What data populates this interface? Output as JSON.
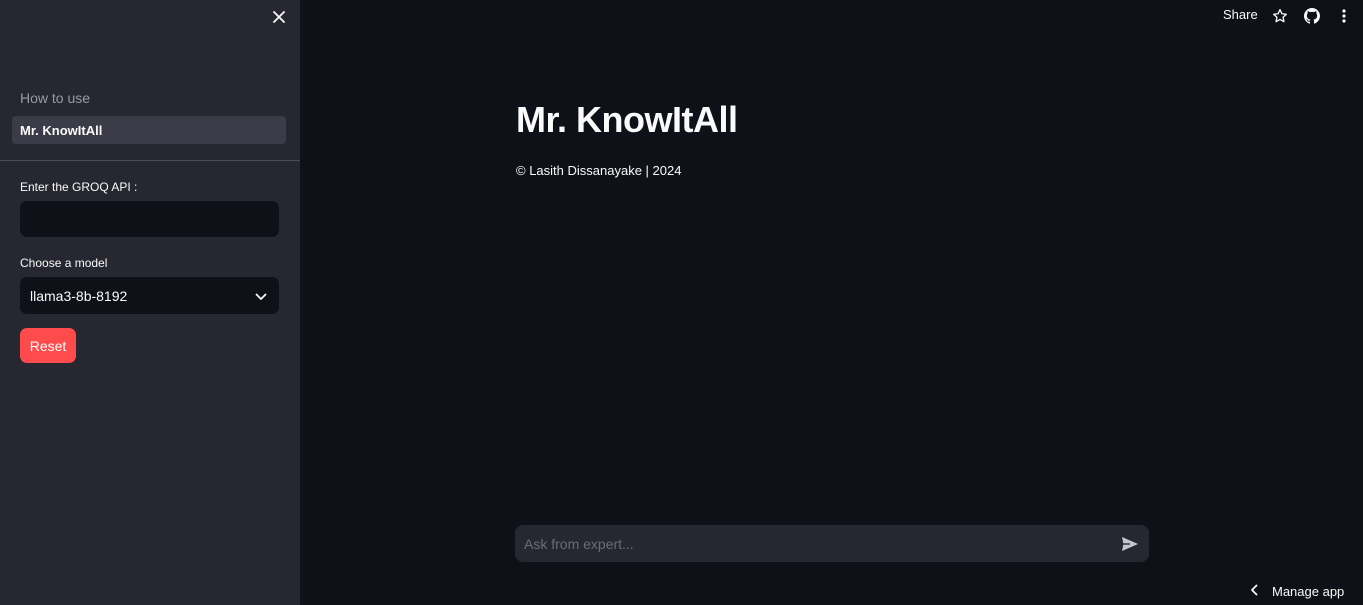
{
  "sidebar": {
    "close_icon": "close-icon",
    "nav": [
      {
        "label": "How to use",
        "active": false
      },
      {
        "label": "Mr. KnowItAll",
        "active": true
      }
    ],
    "api_field": {
      "label": "Enter the GROQ API :",
      "value": ""
    },
    "model_field": {
      "label": "Choose a model",
      "selected": "llama3-8b-8192"
    },
    "reset_label": "Reset"
  },
  "toolbar": {
    "share_label": "Share",
    "icons": [
      "star-icon",
      "github-icon",
      "more-vertical-icon"
    ]
  },
  "main": {
    "title": "Mr. KnowItAll",
    "copyright": "© Lasith Dissanayake | 2024"
  },
  "chat": {
    "placeholder": "Ask from expert...",
    "send_icon": "send-icon"
  },
  "footer": {
    "manage_label": "Manage app"
  },
  "colors": {
    "background": "#0e1117",
    "sidebar": "#262730",
    "accent": "#ff4b4b"
  }
}
